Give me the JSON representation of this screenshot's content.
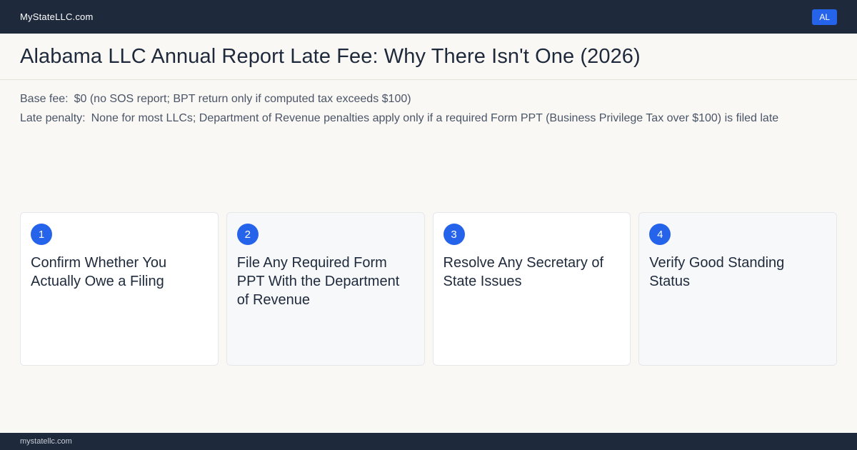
{
  "header": {
    "brand": "MyStateLLC.com",
    "state_badge": "AL"
  },
  "page": {
    "title": "Alabama LLC Annual Report Late Fee: Why There Isn't One (2026)"
  },
  "facts": {
    "base_fee_label": "Base fee:",
    "base_fee_value": "$0 (no SOS report; BPT return only if computed tax exceeds $100)",
    "late_penalty_label": "Late penalty:",
    "late_penalty_value": "None for most LLCs; Department of Revenue penalties apply only if a required Form PPT (Business Privilege Tax over $100) is filed late"
  },
  "steps": [
    {
      "number": "1",
      "title": "Confirm Whether You Actually Owe a Filing"
    },
    {
      "number": "2",
      "title": "File Any Required Form PPT With the Department of Revenue"
    },
    {
      "number": "3",
      "title": "Resolve Any Secretary of State Issues"
    },
    {
      "number": "4",
      "title": "Verify Good Standing Status"
    }
  ],
  "footer": {
    "domain": "mystatellc.com"
  },
  "colors": {
    "header_bg": "#1e293b",
    "accent": "#2563eb",
    "page_bg": "#faf8f4"
  }
}
